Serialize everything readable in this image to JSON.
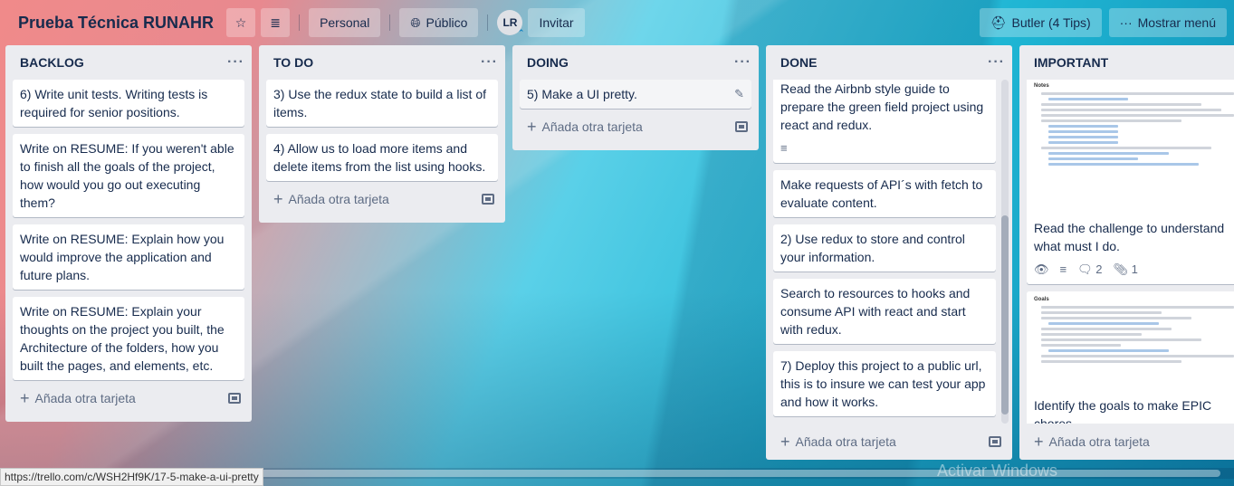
{
  "header": {
    "board_title": "Prueba Técnica RUNAHR",
    "visibility_team": "Personal",
    "visibility_public": "Público",
    "avatar_initials": "LR",
    "invite_label": "Invitar",
    "butler_label": "Butler (4 Tips)",
    "menu_label": "Mostrar menú"
  },
  "add_card_label": "Añada otra tarjeta",
  "lists": [
    {
      "title": "BACKLOG",
      "cards": [
        "6) Write unit tests. Writing tests is required for senior positions.",
        "Write on RESUME: If you weren't able to finish all the goals of the project, how would you go out executing them?",
        "Write on RESUME: Explain how you would improve the application and future plans.",
        "Write on RESUME: Explain your thoughts on the project you built, the Architecture of the folders, how you built the pages, and elements, etc."
      ]
    },
    {
      "title": "TO DO",
      "cards": [
        "3) Use the redux state to build a list of items.",
        "4) Allow us to load more items and delete items from the list using hooks."
      ]
    },
    {
      "title": "DOING",
      "cards": [
        "5) Make a UI pretty."
      ]
    },
    {
      "title": "DONE",
      "cards": [
        "Read the Airbnb style guide to prepare the green field project using react and redux.",
        "Make requests of API´s with fetch to evaluate content.",
        "2) Use redux to store and control your information.",
        "Search to resources to hooks and consume API with react and start with redux.",
        "7) Deploy this project to a public url, this is to insure we can test your app and how it works."
      ]
    },
    {
      "title": "IMPORTANT",
      "cards": [
        "Read the challenge to understand what must I do.",
        "Identify the goals to make EPIC chores."
      ],
      "cover_titles": [
        "Notes",
        "Goals"
      ],
      "badges": {
        "comments": "2",
        "attachments": "1"
      }
    }
  ],
  "status_url": "https://trello.com/c/WSH2Hf9K/17-5-make-a-ui-pretty",
  "watermark": "Activar Windows"
}
